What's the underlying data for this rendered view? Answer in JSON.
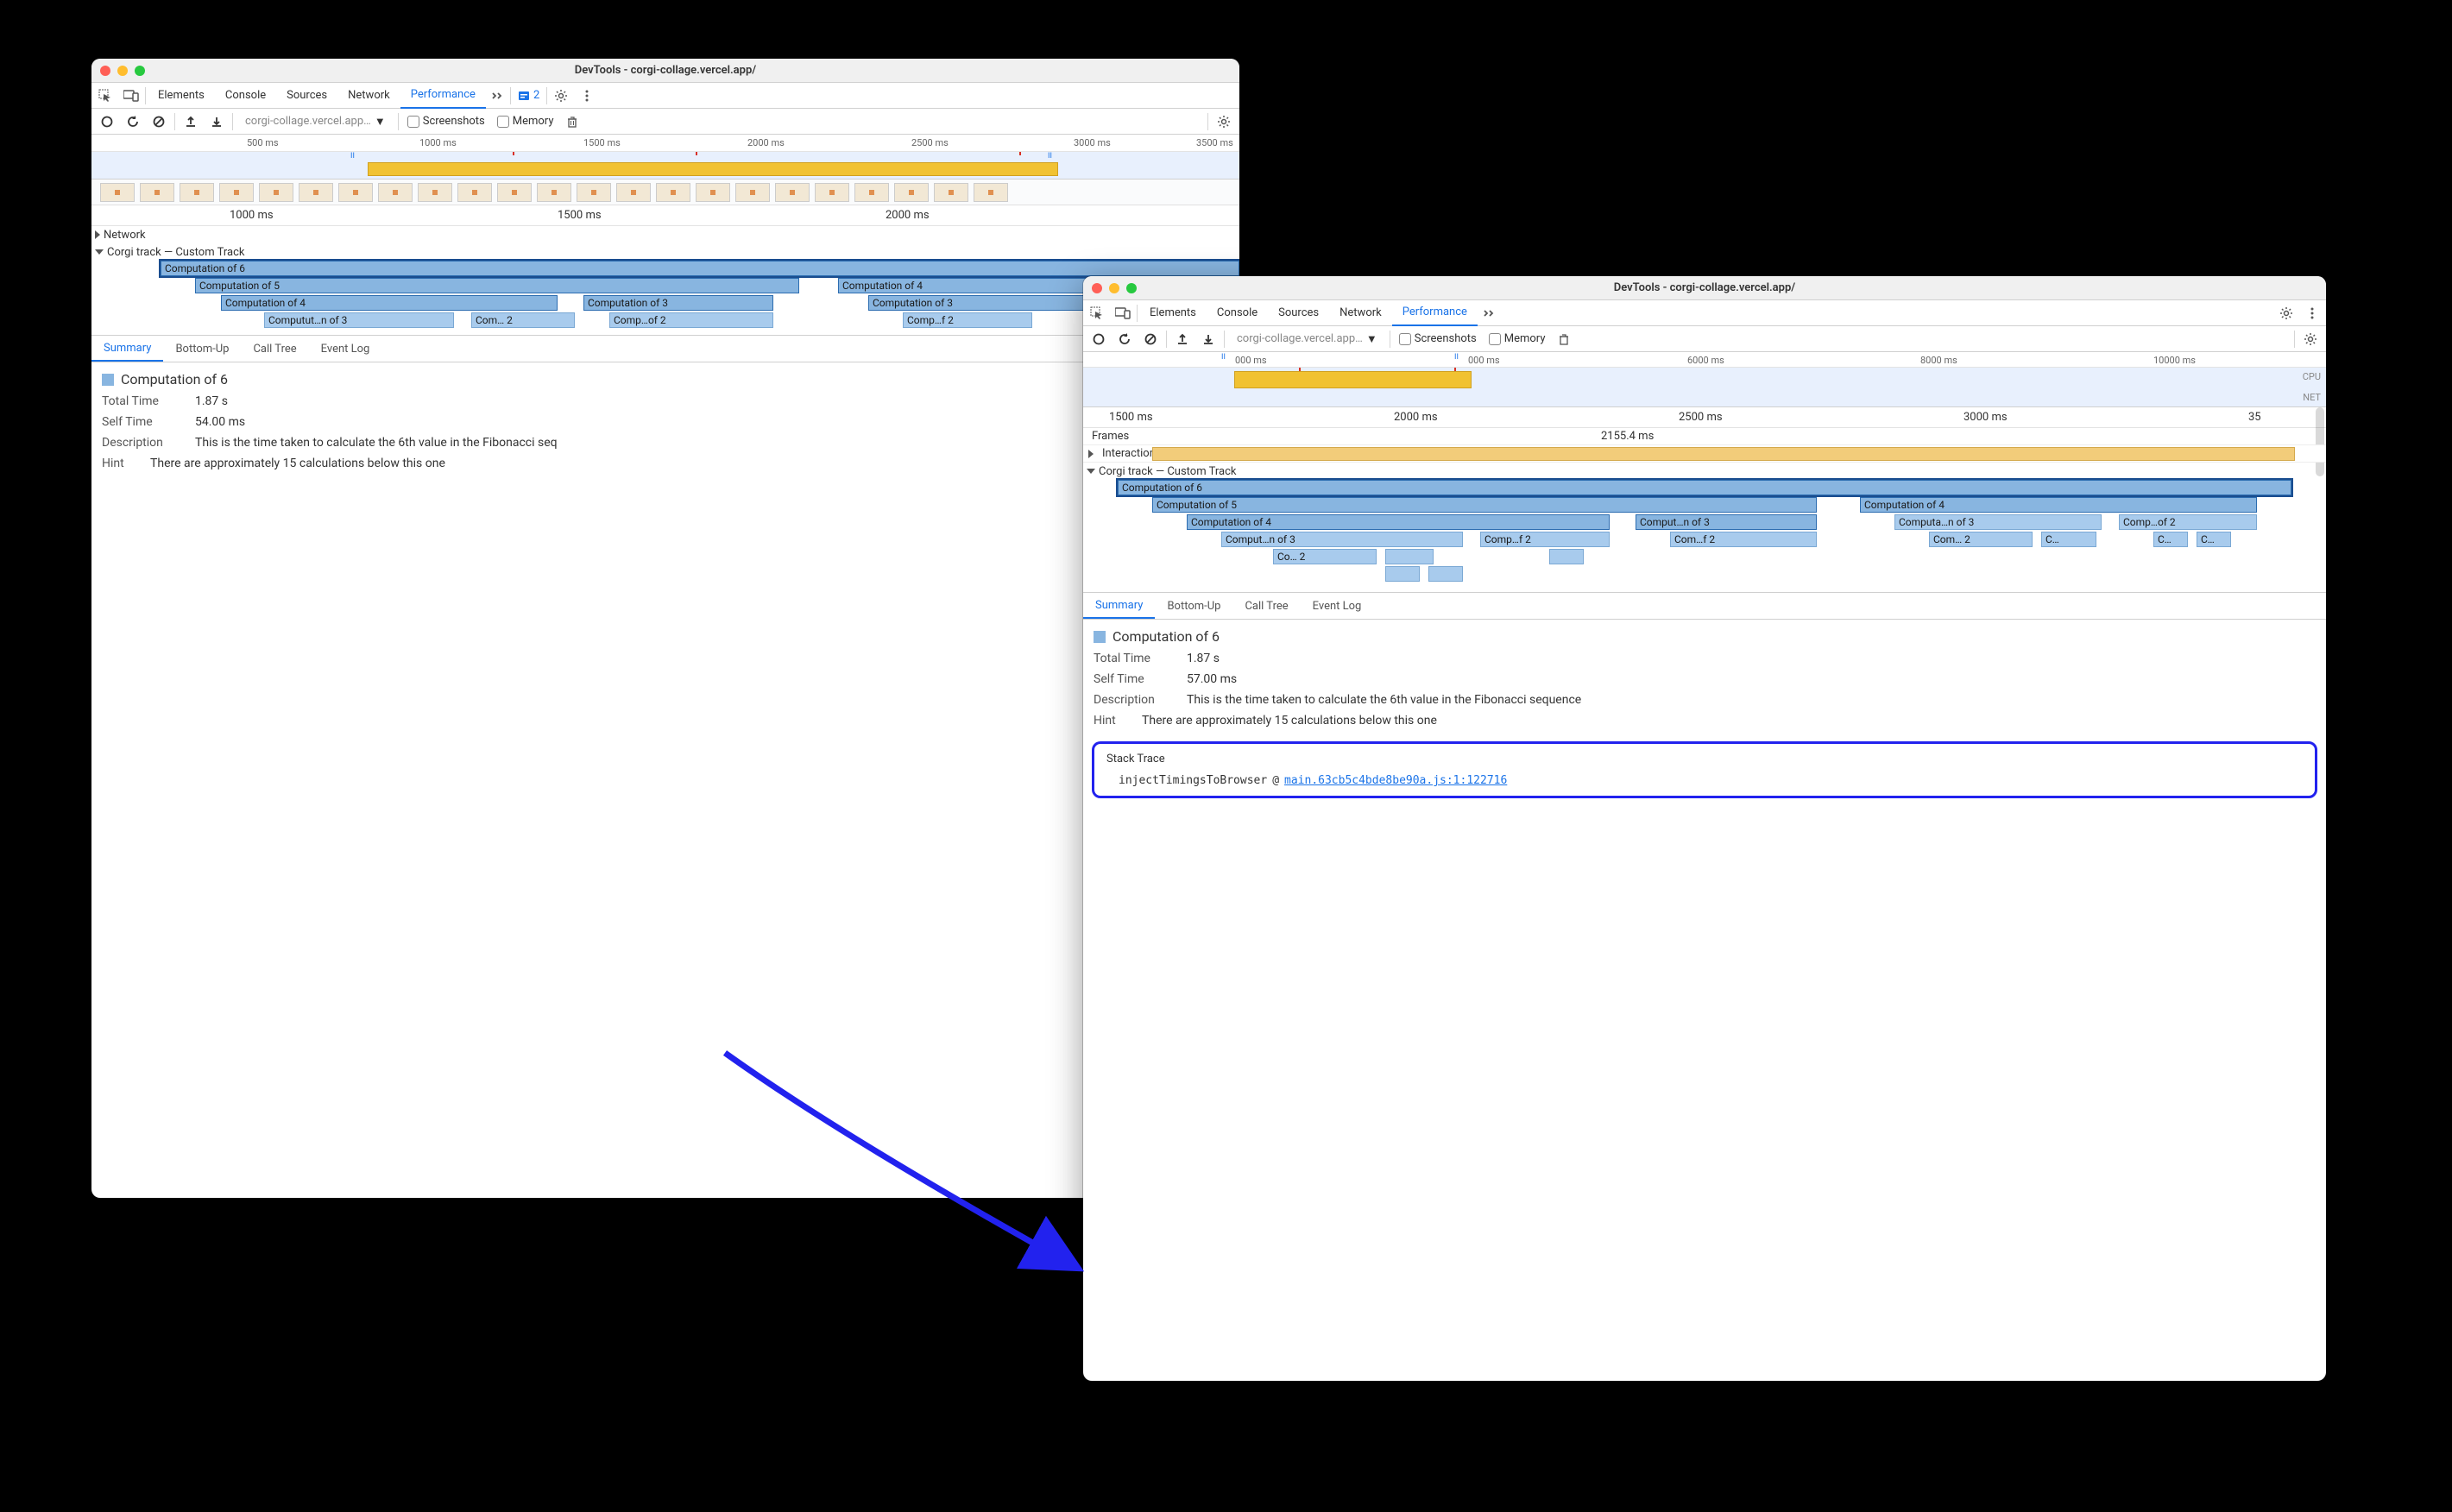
{
  "shared": {
    "title": "DevTools - corgi-collage.vercel.app/",
    "main_tabs": [
      "Elements",
      "Console",
      "Sources",
      "Network",
      "Performance"
    ],
    "active_tab": "Performance",
    "issue_count": "2",
    "url_selector": "corgi-collage.vercel.app…",
    "screenshots_label": "Screenshots",
    "memory_label": "Memory",
    "detail_tabs": [
      "Summary",
      "Bottom-Up",
      "Call Tree",
      "Event Log"
    ],
    "custom_track_label": "Corgi track — Custom Track",
    "network_label": "Network",
    "frames_label": "Frames",
    "interactions_label": "Interactions"
  },
  "left": {
    "overview_ticks": [
      "500 ms",
      "1000 ms",
      "1500 ms",
      "2000 ms",
      "2500 ms",
      "3000 ms",
      "3500 ms"
    ],
    "main_ticks": [
      "1000 ms",
      "1500 ms",
      "2000 ms"
    ],
    "flame": {
      "c6": "Computation of 6",
      "c5": "Computation of 5",
      "c4a": "Computation of 4",
      "c4b": "Computation of 4",
      "c3a": "Computation of 3",
      "c3b": "Computut…n of 3",
      "c3c": "Computation of 3",
      "c2a": "Com… 2",
      "c2b": "Comp…of 2",
      "c2c": "Comp…f 2"
    },
    "detail": {
      "title": "Computation of 6",
      "total_k": "Total Time",
      "total_v": "1.87 s",
      "self_k": "Self Time",
      "self_v": "54.00 ms",
      "desc_k": "Description",
      "desc_v": "This is the time taken to calculate the 6th value in the Fibonacci seq",
      "hint_k": "Hint",
      "hint_v": "There are approximately 15 calculations below this one"
    }
  },
  "right": {
    "overview_ticks": [
      "000 ms",
      "000 ms",
      "6000 ms",
      "8000 ms",
      "10000 ms"
    ],
    "cpu_label": "CPU",
    "net_label": "NET",
    "main_ticks": [
      "1500 ms",
      "2000 ms",
      "2500 ms",
      "3000 ms",
      "35"
    ],
    "frame_time": "2155.4 ms",
    "flame": {
      "c6": "Computation of 6",
      "c5": "Computation of 5",
      "c4a": "Computation of 4",
      "c4b": "Computation of 4",
      "c3a": "Comput…n of 3",
      "c3b": "Computa…n of 3",
      "c3c": "Comput…n of 3",
      "c2a": "Comp…of 2",
      "c2b": "Comp…f 2",
      "c2c": "Com…f 2",
      "c2d": "Com… 2",
      "c2e": "Co… 2",
      "cx1": "C…",
      "cx2": "C…"
    },
    "detail": {
      "title": "Computation of 6",
      "total_k": "Total Time",
      "total_v": "1.87 s",
      "self_k": "Self Time",
      "self_v": "57.00 ms",
      "desc_k": "Description",
      "desc_v": "This is the time taken to calculate the 6th value in the Fibonacci sequence",
      "hint_k": "Hint",
      "hint_v": "There are approximately 15 calculations below this one",
      "stack_title": "Stack Trace",
      "stack_fn": "injectTimingsToBrowser",
      "stack_at": "@",
      "stack_link": "main.63cb5c4bde8be90a.js:1:122716"
    }
  }
}
